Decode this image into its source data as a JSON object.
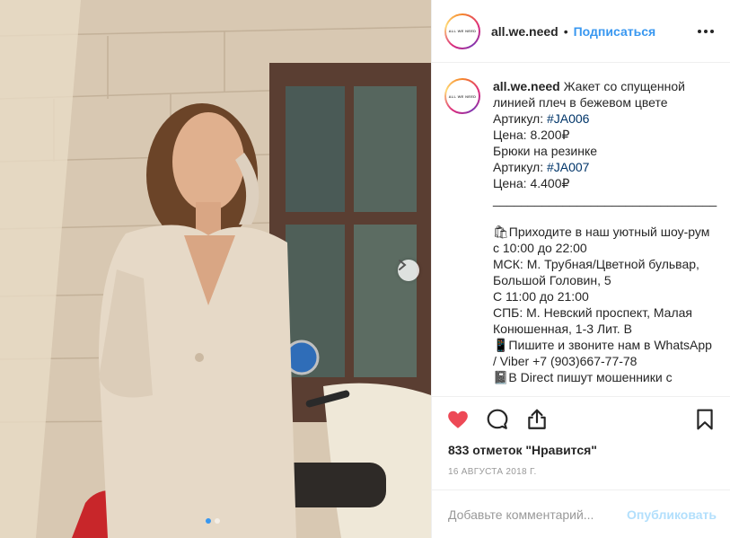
{
  "post": {
    "username": "all.we.need",
    "avatar_text": "ALL WE NEED",
    "separator": "•",
    "follow_label": "Подписаться",
    "carousel": {
      "total_slides": 2,
      "active_slide": 1
    }
  },
  "caption": {
    "username": "all.we.need",
    "lines": [
      {
        "text": "Жакет со спущенной линией плеч в бежевом цвете"
      },
      {
        "prefix": "Артикул: ",
        "tag": "#JA006"
      },
      {
        "text": "Цена: 8.200₽"
      },
      {
        "text": "Брюки на резинке"
      },
      {
        "prefix": "Артикул: ",
        "tag": "#JA007"
      },
      {
        "text": "Цена: 4.400₽"
      },
      {
        "text": "________________________________"
      },
      {
        "text": ""
      },
      {
        "text": "🛍Приходите в наш уютный шоу-рум с 10:00 до 22:00"
      },
      {
        "text": "МСК: М. Трубная/Цветной бульвар, Большой Головин, 5"
      },
      {
        "text": "С 11:00 до 21:00"
      },
      {
        "text": "СПБ: М. Невский проспект, Малая Конюшенная, 1-3 Лит. В"
      },
      {
        "text": "📱Пишите и звоните нам в WhatsApp / Viber +7 (903)667-77-78"
      },
      {
        "text": "📓В Direct пишут мошенники с"
      }
    ]
  },
  "actions": {
    "like_color": "#ed4956"
  },
  "likes_text": "833 отметок \"Нравится\"",
  "date_text": "16 августа 2018 г.",
  "comment": {
    "placeholder": "Добавьте комментарий...",
    "publish_label": "Опубликовать"
  },
  "colors": {
    "accent": "#3897f0",
    "hashtag": "#003569",
    "publish_disabled": "#b2dffc"
  }
}
